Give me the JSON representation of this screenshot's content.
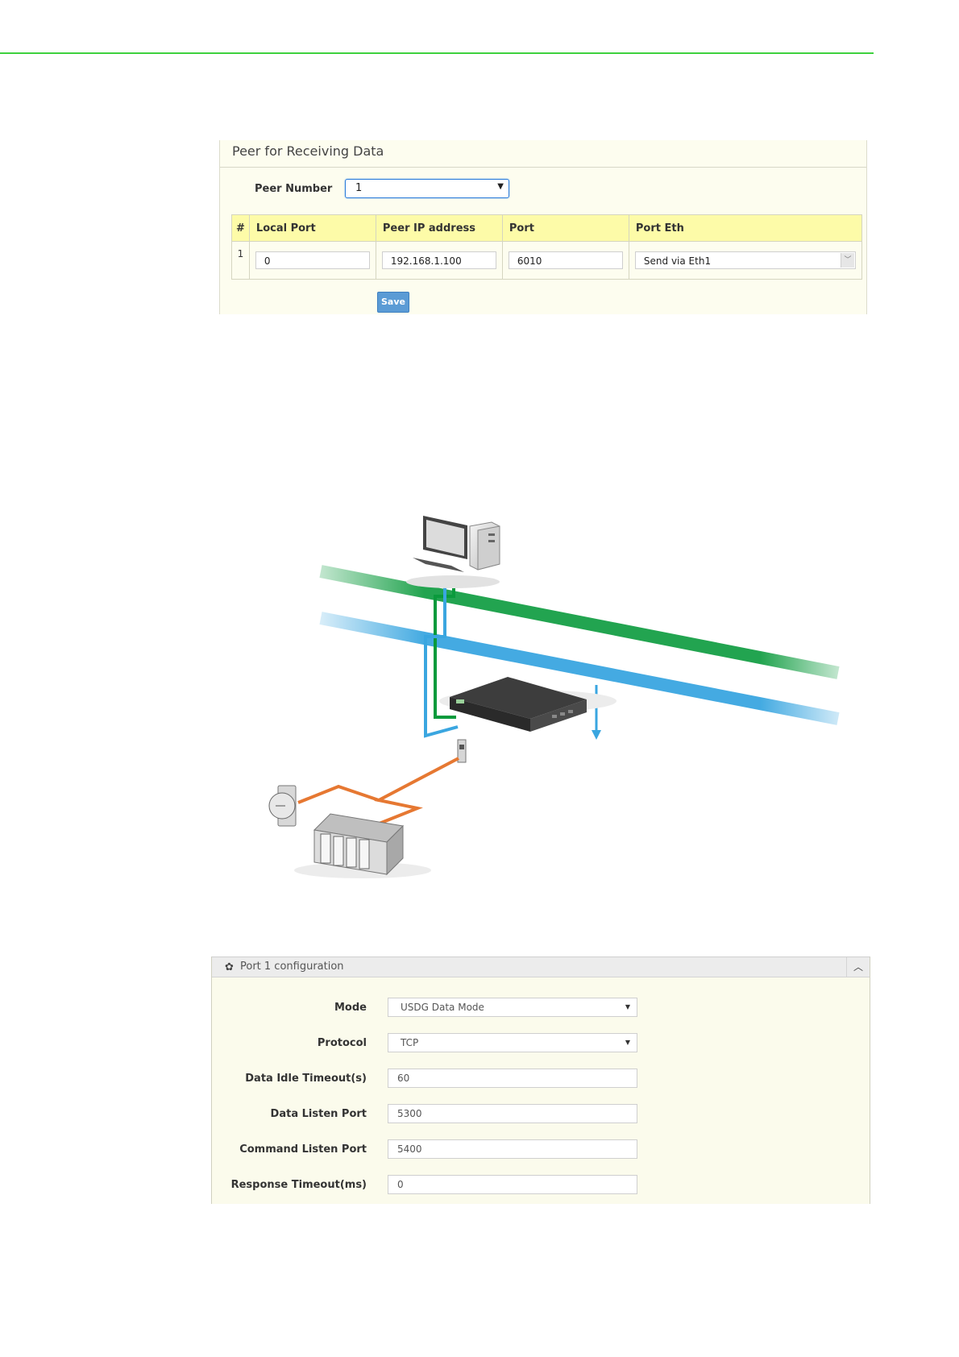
{
  "peer_panel": {
    "title": "Peer for Receiving Data",
    "peer_number_label": "Peer Number",
    "peer_number_value": "1",
    "columns": [
      "#",
      "Local Port",
      "Peer IP address",
      "Port",
      "Port Eth"
    ],
    "rows": [
      {
        "num": "1",
        "local_port": "0",
        "peer_ip": "192.168.1.100",
        "port": "6010",
        "port_eth": "Send via Eth1"
      }
    ],
    "save_label": "Save"
  },
  "diagram": {
    "colors": {
      "green": "#0a9a3c",
      "blue": "#3aa6e0",
      "orange": "#e67832"
    },
    "icons": [
      "desktop-computer-icon",
      "ethernet-switch-icon",
      "serial-device-server-icon",
      "field-sensor-icon",
      "plc-controller-icon"
    ]
  },
  "port_config": {
    "title": "Port 1 configuration",
    "fields": [
      {
        "label": "Mode",
        "value": "USDG Data Mode",
        "type": "select"
      },
      {
        "label": "Protocol",
        "value": "TCP",
        "type": "select"
      },
      {
        "label": "Data Idle Timeout(s)",
        "value": "60",
        "type": "input"
      },
      {
        "label": "Data Listen Port",
        "value": "5300",
        "type": "input"
      },
      {
        "label": "Command Listen Port",
        "value": "5400",
        "type": "input"
      },
      {
        "label": "Response Timeout(ms)",
        "value": "0",
        "type": "input"
      }
    ]
  }
}
